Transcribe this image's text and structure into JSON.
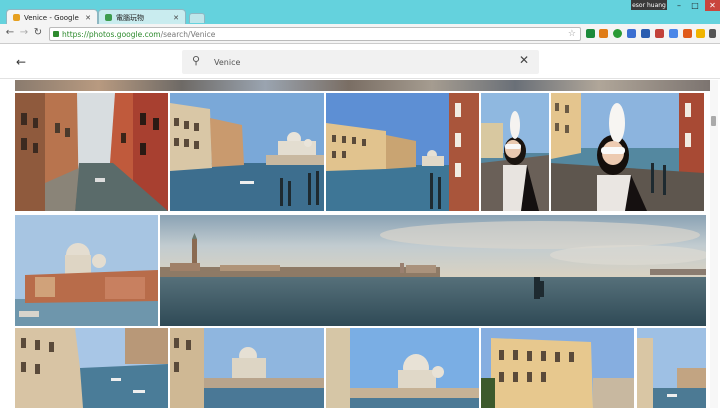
{
  "browser": {
    "tabs": [
      {
        "title": "Venice - Google 相簿",
        "favicon_color": "#e6a020"
      },
      {
        "title": "電腦玩物",
        "favicon_color": "#3d9c4e"
      }
    ],
    "user": "esor huang",
    "window_buttons": {
      "minimize": "–",
      "maximize": "□",
      "close": "✕"
    },
    "url_host": "https://photos.google.com",
    "url_path": "/search/Venice",
    "nav": {
      "back": "←",
      "forward": "→",
      "reload": "↻"
    },
    "extension_colors": [
      "#1b8a3a",
      "#e07c17",
      "#2a9a35",
      "#3b6fd1",
      "#2a5db0",
      "#c2413a",
      "#4a86e8",
      "#777777",
      "#e05a1a",
      "#f0b400",
      "#2b6fcc",
      "#555555"
    ]
  },
  "search": {
    "back_icon": "←",
    "search_icon": "🔍",
    "query": "Venice",
    "clear_icon": "✕"
  },
  "photos": [
    {
      "id": "venice-canal-street"
    },
    {
      "id": "venice-grand-canal-1"
    },
    {
      "id": "venice-grand-canal-2"
    },
    {
      "id": "venice-masked-woman-1"
    },
    {
      "id": "venice-masked-woman-2"
    },
    {
      "id": "venice-salute-1"
    },
    {
      "id": "venice-panorama"
    },
    {
      "id": "venice-canal-boats"
    },
    {
      "id": "venice-salute-2"
    },
    {
      "id": "venice-salute-3"
    },
    {
      "id": "venice-palace"
    },
    {
      "id": "venice-canal-3"
    }
  ]
}
